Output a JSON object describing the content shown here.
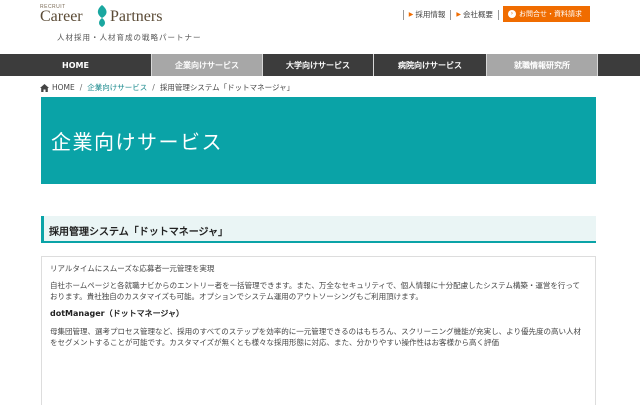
{
  "header": {
    "logo_small": "RECRUIT",
    "logo_word1": "Career",
    "logo_word2": "Partners",
    "tagline": "人材採用・人材育成の戦略パートナー",
    "util_links": [
      "採用情報",
      "会社概要"
    ],
    "cta_label": "お問合せ・資料請求",
    "accent_color": "#f06c00"
  },
  "nav": {
    "items": [
      "HOME",
      "企業向けサービス",
      "大学向けサービス",
      "病院向けサービス",
      "就職情報研究所"
    ],
    "active_index": 1
  },
  "breadcrumb": {
    "home": "HOME",
    "level1": "企業向けサービス",
    "current": "採用管理システム「ドットマネージャ」"
  },
  "hero": {
    "title": "企業向けサービス",
    "color": "#0aa3a7"
  },
  "section": {
    "title": "採用管理システム「ドットマネージャ」"
  },
  "content": {
    "lead": "リアルタイムにスムーズな応募者一元管理を実現",
    "para1": "自社ホームページと各就職ナビからのエントリー者を一括管理できます。また、万全なセキュリティで、個人情報に十分配慮したシステム構築・運営を行っております。貴社独自のカスタマイズも可能。オプションでシステム運用のアウトソーシングもご利用頂けます。",
    "subhead": "dotManager（ドットマネージャ）",
    "para2": "母集団管理、選考プロセス管理など、採用のすべてのステップを効率的に一元管理できるのはもちろん、スクリーニング機能が充実し、より優先度の高い人材をセグメントすることが可能です。カスタマイズが無くとも様々な採用形態に対応、また、分かりやすい操作性はお客様から高く評価"
  }
}
